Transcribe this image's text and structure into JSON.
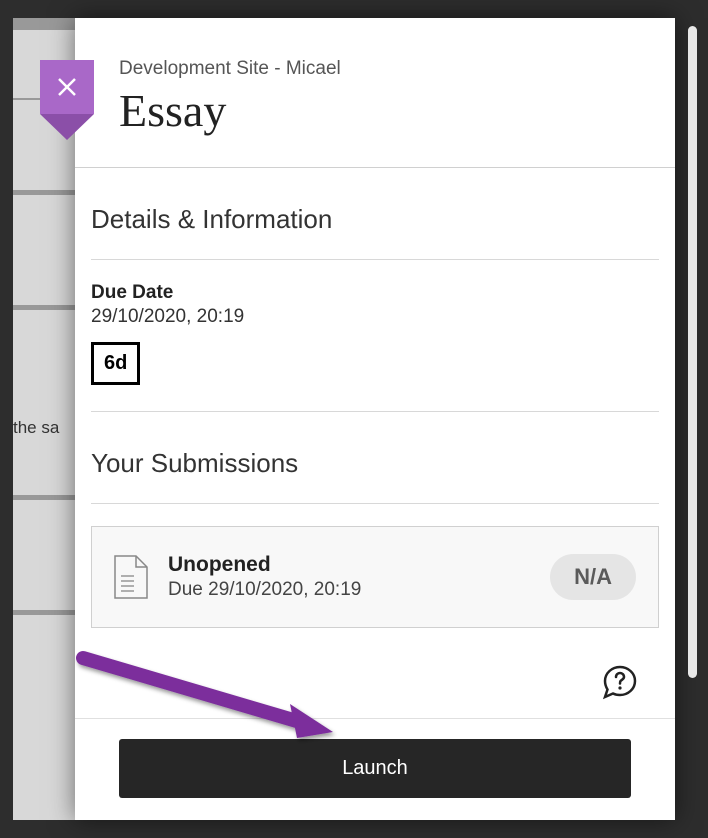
{
  "background": {
    "partial_text": "the sa"
  },
  "header": {
    "site_name": "Development Site - Micael",
    "title": "Essay"
  },
  "details": {
    "section_title": "Details & Information",
    "due_label": "Due Date",
    "due_value": "29/10/2020, 20:19",
    "days_remaining": "6d"
  },
  "submissions": {
    "section_title": "Your Submissions",
    "items": [
      {
        "status": "Unopened",
        "due_text": "Due 29/10/2020, 20:19",
        "grade": "N/A"
      }
    ]
  },
  "footer": {
    "launch_label": "Launch"
  }
}
